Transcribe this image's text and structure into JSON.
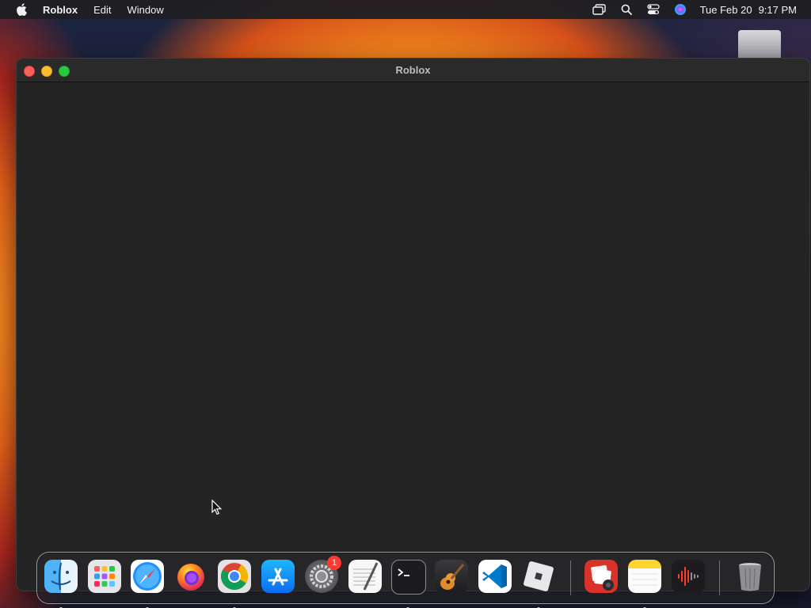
{
  "menubar": {
    "app_name": "Roblox",
    "menus": [
      "Edit",
      "Window"
    ],
    "status_icons": [
      "screen-mirroring-icon",
      "spotlight-search-icon",
      "control-center-icon",
      "siri-icon"
    ],
    "date": "Tue Feb 20",
    "time": "9:17 PM"
  },
  "window": {
    "title": "Roblox"
  },
  "dock": {
    "apps": [
      {
        "name": "finder-icon",
        "running": true
      },
      {
        "name": "launchpad-icon",
        "running": false
      },
      {
        "name": "safari-icon",
        "running": true
      },
      {
        "name": "firefox-icon",
        "running": false
      },
      {
        "name": "chrome-icon",
        "running": true
      },
      {
        "name": "app-store-icon",
        "running": false
      },
      {
        "name": "system-settings-icon",
        "running": false,
        "badge": "1"
      },
      {
        "name": "textedit-icon",
        "running": false
      },
      {
        "name": "terminal-icon",
        "running": true
      },
      {
        "name": "garageband-icon",
        "running": false
      },
      {
        "name": "vscode-icon",
        "running": false
      },
      {
        "name": "roblox-icon",
        "running": true
      },
      {
        "name": "photo-booth-icon",
        "running": false
      },
      {
        "name": "notes-icon",
        "running": true
      },
      {
        "name": "voice-memos-icon",
        "running": false
      },
      {
        "name": "trash-icon",
        "running": false
      }
    ]
  },
  "colors": {
    "window_bg": "#242424",
    "titlebar_bg": "#2a2a2a",
    "close": "#fe5f57",
    "minimize": "#febc2e",
    "zoom": "#28c840"
  }
}
